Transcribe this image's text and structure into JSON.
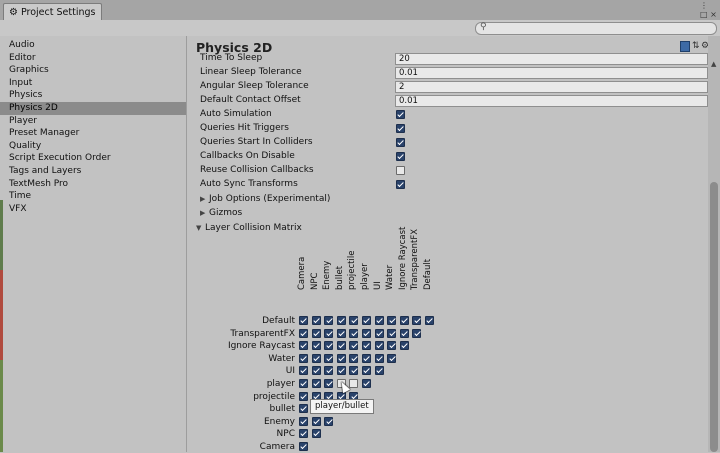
{
  "window": {
    "tab_title": "Project Settings",
    "controls": {
      "more": "⋮",
      "close": "□ ×"
    }
  },
  "search": {
    "placeholder": ""
  },
  "sidebar": {
    "items": [
      "Audio",
      "Editor",
      "Graphics",
      "Input",
      "Physics",
      "Physics 2D",
      "Player",
      "Preset Manager",
      "Quality",
      "Script Execution Order",
      "Tags and Layers",
      "TextMesh Pro",
      "Time",
      "VFX"
    ],
    "selected": "Physics 2D"
  },
  "main": {
    "title": "Physics 2D",
    "fields": [
      {
        "label": "Time To Sleep",
        "value": "20"
      },
      {
        "label": "Linear Sleep Tolerance",
        "value": "0.01"
      },
      {
        "label": "Angular Sleep Tolerance",
        "value": "2"
      },
      {
        "label": "Default Contact Offset",
        "value": "0.01"
      }
    ],
    "toggles": [
      {
        "label": "Auto Simulation",
        "checked": true
      },
      {
        "label": "Queries Hit Triggers",
        "checked": true
      },
      {
        "label": "Queries Start In Colliders",
        "checked": true
      },
      {
        "label": "Callbacks On Disable",
        "checked": true
      },
      {
        "label": "Reuse Collision Callbacks",
        "checked": false
      },
      {
        "label": "Auto Sync Transforms",
        "checked": true
      }
    ],
    "foldouts": [
      {
        "label": "Job Options (Experimental)",
        "expanded": false
      },
      {
        "label": "Gizmos",
        "expanded": false
      },
      {
        "label": "Layer Collision Matrix",
        "expanded": true
      }
    ]
  },
  "matrix": {
    "layers": [
      "Default",
      "TransparentFX",
      "Ignore Raycast",
      "Water",
      "UI",
      "player",
      "projectile",
      "bullet",
      "Enemy",
      "NPC",
      "Camera"
    ],
    "columns": [
      "Camera",
      "NPC",
      "Enemy",
      "bullet",
      "projectile",
      "player",
      "UI",
      "Water",
      "Ignore Raycast",
      "TransparentFX",
      "Default"
    ],
    "unchecked": [
      [
        5,
        3
      ],
      [
        5,
        4
      ]
    ],
    "tooltip": "player/bullet"
  }
}
